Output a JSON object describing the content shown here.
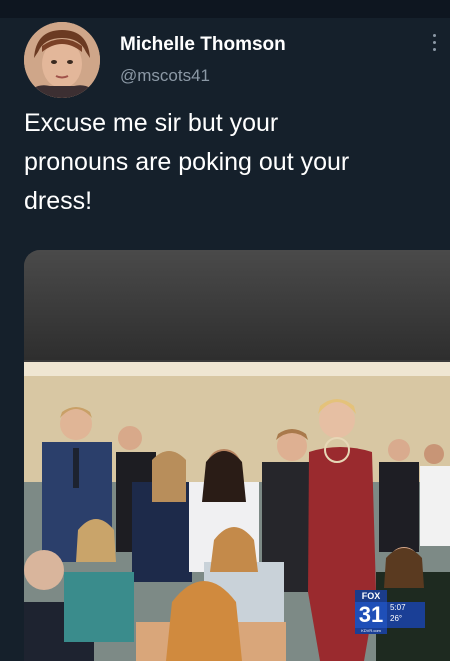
{
  "tweet": {
    "display_name": "Michelle Thomson",
    "handle": "@mscots41",
    "text_line1": "Excuse me sir but your",
    "text_line2": "pronouns are poking out your",
    "text_line3": "dress!"
  },
  "media": {
    "broadcast": {
      "network": "FOX",
      "channel": "31",
      "time": "5:07",
      "temp": "26°",
      "site": "KDVR.com"
    }
  },
  "icons": {
    "more": "more-vertical-icon",
    "avatar": "avatar-image"
  },
  "colors": {
    "background": "#15202b",
    "text": "#ffffff",
    "muted": "#8b98a5"
  }
}
